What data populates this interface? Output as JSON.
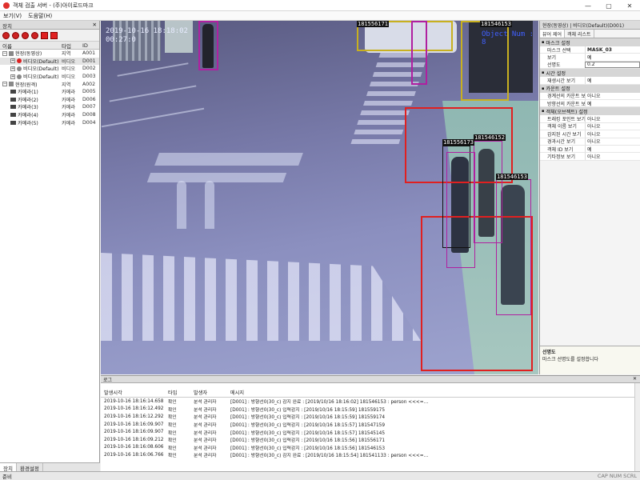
{
  "window": {
    "title": "객체 검출 서버 - (주)아이로드마크",
    "minimize": "—",
    "maximize": "▢",
    "close": "✕"
  },
  "menu": [
    "보기(V)",
    "도움말(H)"
  ],
  "left_panel": {
    "title": "장치",
    "columns": {
      "name": "이름",
      "type": "타입",
      "id": "ID"
    },
    "rows": [
      {
        "name": "현장(동영상)",
        "type": "지역",
        "id": "A001",
        "level": 0,
        "icon": "site-icon",
        "expander": "−"
      },
      {
        "name": "비디오(Default)",
        "type": "비디오",
        "id": "D001",
        "level": 1,
        "icon": "video-icon",
        "expander": "+"
      },
      {
        "name": "비디오(Default)",
        "type": "비디오",
        "id": "D002",
        "level": 1,
        "icon": "video-icon",
        "expander": "+"
      },
      {
        "name": "비디오(Default)",
        "type": "비디오",
        "id": "D003",
        "level": 1,
        "icon": "video-icon",
        "expander": "+"
      },
      {
        "name": "현장(원격)",
        "type": "지역",
        "id": "A002",
        "level": 0,
        "icon": "site-icon",
        "expander": "−"
      },
      {
        "name": "카메라(1)",
        "type": "카메라",
        "id": "D005",
        "level": 1,
        "icon": "camera-icon",
        "expander": ""
      },
      {
        "name": "카메라(2)",
        "type": "카메라",
        "id": "D006",
        "level": 1,
        "icon": "camera-icon",
        "expander": ""
      },
      {
        "name": "카메라(3)",
        "type": "카메라",
        "id": "D007",
        "level": 1,
        "icon": "camera-icon",
        "expander": ""
      },
      {
        "name": "카메라(4)",
        "type": "카메라",
        "id": "D008",
        "level": 1,
        "icon": "camera-icon",
        "expander": ""
      },
      {
        "name": "카메라(5)",
        "type": "카메라",
        "id": "D004",
        "level": 1,
        "icon": "camera-icon",
        "expander": ""
      }
    ],
    "tabs": [
      "장치",
      "환경설정"
    ]
  },
  "video": {
    "timestamp": "2019-10-16 18:18:02",
    "framecount": "00:27:0",
    "object_num": "Object Num : 8",
    "labels": [
      "181556171",
      "181546153",
      "181556173",
      "181546152",
      "181546153"
    ]
  },
  "right_panel": {
    "title": "현장(동영상) | 비디오(Default)(D001)",
    "tabs": [
      "뷰어 제어",
      "객체 리스트"
    ],
    "categories": [
      {
        "title": "마스크 설정",
        "rows": [
          {
            "key": "마스크 선택",
            "value": "MASK_03",
            "bold": true
          },
          {
            "key": "보기",
            "value": "예"
          },
          {
            "key": "선명도",
            "value": "0.2",
            "selected": true
          }
        ]
      },
      {
        "title": "시간 설정",
        "rows": [
          {
            "key": "재생시간 보기",
            "value": "예"
          }
        ]
      },
      {
        "title": "카운트 설정",
        "rows": [
          {
            "key": "경계선의 카운트 보기",
            "value": "아니오"
          },
          {
            "key": "방향선의 카운트 보기",
            "value": "예"
          }
        ]
      },
      {
        "title": "객체(오브젝트) 설정",
        "rows": [
          {
            "key": "트래킹 포인트 보기",
            "value": "아니오"
          },
          {
            "key": "객체 이름 보기",
            "value": "아니오"
          },
          {
            "key": "감지된 시간 보기",
            "value": "아니오"
          },
          {
            "key": "경과시간 보기",
            "value": "아니오"
          },
          {
            "key": "객체 ID 보기",
            "value": "예"
          },
          {
            "key": "기타정보 보기",
            "value": "아니오"
          }
        ]
      }
    ],
    "description": {
      "title": "선명도",
      "text": "마스크 선명도를 설정합니다"
    }
  },
  "log_panel": {
    "title": "로그",
    "columns": {
      "time": "발생시각",
      "level": "타입",
      "user": "발생자",
      "message": "메시지"
    },
    "rows": [
      {
        "time": "2019-10-16 18:16:14.658",
        "level": "확인",
        "user": "분석 관리자",
        "message": "[D001] : 방향선0(30_c) 감지 완료 : [2019/10/16 18:16:02] 181546153 : person <<<=..."
      },
      {
        "time": "2019-10-16 18:16:12.492",
        "level": "확인",
        "user": "분석 관리자",
        "message": "[D001] : 방향선0(30_c) 입력감지 : [2019/10/16 18:15:59] 181559175"
      },
      {
        "time": "2019-10-16 18:16:12.292",
        "level": "확인",
        "user": "분석 관리자",
        "message": "[D001] : 방향선0(30_c) 입력감지 : [2019/10/16 18:15:59] 181559174"
      },
      {
        "time": "2019-10-16 18:16:09.907",
        "level": "확인",
        "user": "분석 관리자",
        "message": "[D001] : 방향선0(30_c) 입력감지 : [2019/10/16 18:15:57] 181547159"
      },
      {
        "time": "2019-10-16 18:16:09.907",
        "level": "확인",
        "user": "분석 관리자",
        "message": "[D001] : 방향선0(30_c) 입력감지 : [2019/10/16 18:15:57] 181545145"
      },
      {
        "time": "2019-10-16 18:16:09.212",
        "level": "확인",
        "user": "분석 관리자",
        "message": "[D001] : 방향선0(30_c) 입력감지 : [2019/10/16 18:15:56] 181556171"
      },
      {
        "time": "2019-10-16 18:16:08.606",
        "level": "확인",
        "user": "분석 관리자",
        "message": "[D001] : 방향선0(30_c) 입력감지 : [2019/10/16 18:15:56] 181546153"
      },
      {
        "time": "2019-10-16 18:16:06.766",
        "level": "확인",
        "user": "분석 관리자",
        "message": "[D001] : 방향선0(30_c) 감지 완료 : [2019/10/16 18:15:54] 181541133 : person <<<=..."
      }
    ]
  },
  "status": {
    "text": "준비",
    "indicators": "CAP NUM SCRL"
  }
}
